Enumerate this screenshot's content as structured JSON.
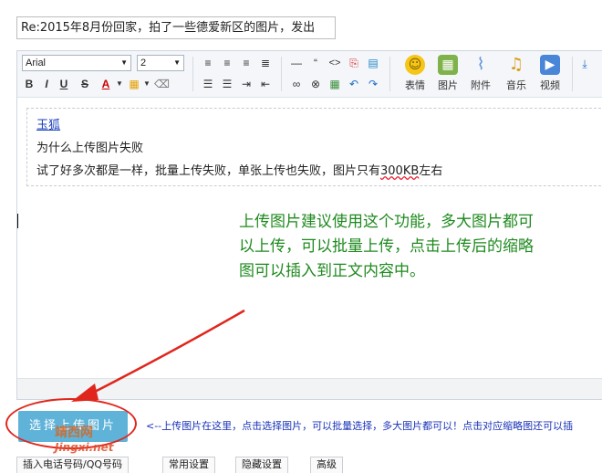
{
  "subject": {
    "value": "Re:2015年8月份回家，拍了一些德爱新区的图片，发出"
  },
  "toolbar": {
    "font_family": "Arial",
    "font_size": "2",
    "buttons": {
      "bold": "B",
      "italic": "I",
      "underline": "U",
      "strike": "S",
      "forecolor": "A",
      "quote": "“",
      "code": "<>"
    },
    "big_buttons": [
      {
        "label": "表情",
        "icon": "emoticon-icon",
        "color": "#f5c518",
        "glyph": "☺"
      },
      {
        "label": "图片",
        "icon": "image-icon",
        "color": "#7fb24a",
        "glyph": "▦"
      },
      {
        "label": "附件",
        "icon": "paperclip-icon",
        "color": "#5b8fd6",
        "glyph": "⌇"
      },
      {
        "label": "音乐",
        "icon": "music-icon",
        "color": "#e0a020",
        "glyph": "♫"
      },
      {
        "label": "视频",
        "icon": "video-icon",
        "color": "#4a86d8",
        "glyph": "▶"
      }
    ]
  },
  "content": {
    "mention": "玉狐",
    "line1": "为什么上传图片失败",
    "line2_prefix": "试了好多次都是一样，批量上传失败，单张上传也失败，图片只有",
    "line2_size": "300KB",
    "line2_suffix": "左右"
  },
  "annotation": {
    "lines": [
      "上传图片建议使用这个功能，多大图片都可",
      "以上传，可以批量上传，点击上传后的缩略",
      "图可以插入到正文内容中。"
    ],
    "color": "#1f8a1f"
  },
  "upload": {
    "button_label": "选择上传图片",
    "hint": "<--上传图片在这里，点击选择图片，可以批量选择，多大图片都可以！点击对应缩略图还可以插"
  },
  "watermark": {
    "cn": "靖西网",
    "en": "Jingxi.net"
  },
  "bottom_tabs": [
    "插入电话号码/QQ号码",
    "常用设置",
    "隐藏设置",
    "高级"
  ]
}
